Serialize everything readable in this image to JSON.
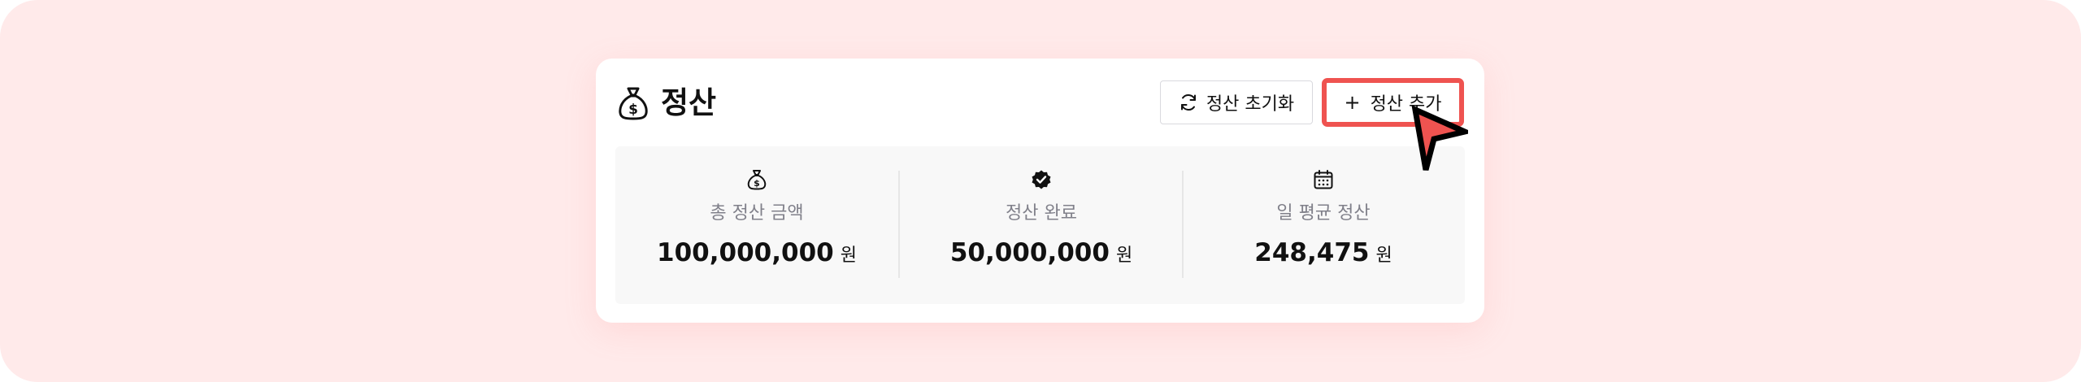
{
  "header": {
    "title": "정산",
    "title_icon": "money-bag-icon"
  },
  "actions": {
    "reset_label": "정산 초기화",
    "reset_icon": "refresh-icon",
    "add_label": "정산 추가",
    "add_icon": "+",
    "highlight_color": "#ef5350"
  },
  "stats": [
    {
      "icon": "money-bag-icon",
      "label": "총 정산 금액",
      "value": "100,000,000",
      "unit": "원"
    },
    {
      "icon": "verified-check-icon",
      "label": "정산 완료",
      "value": "50,000,000",
      "unit": "원"
    },
    {
      "icon": "calendar-icon",
      "label": "일 평균 정산",
      "value": "248,475",
      "unit": "원"
    }
  ],
  "colors": {
    "background": "#ffeaea",
    "card": "#ffffff",
    "panel": "#f8f8f8",
    "cursor": "#ef5350"
  }
}
